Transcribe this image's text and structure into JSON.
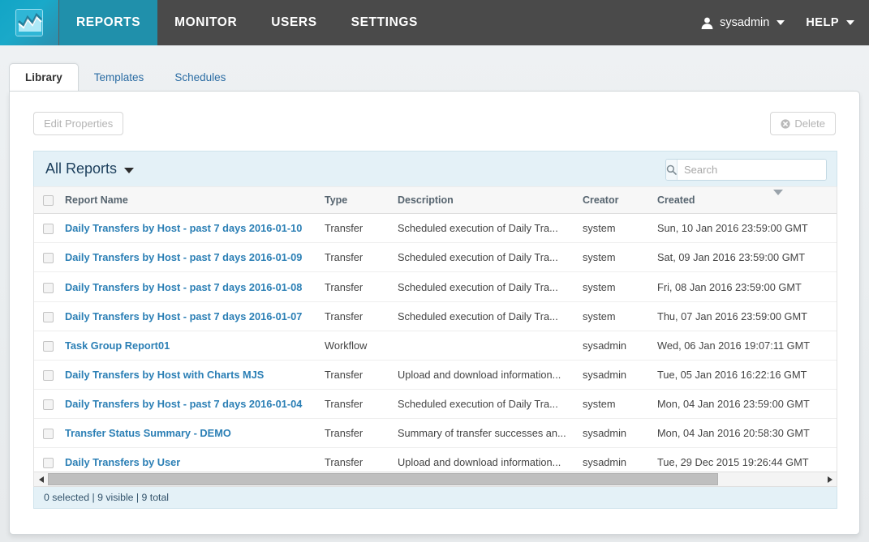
{
  "brand": {
    "logo_icon": "chart-logo-icon",
    "accent": "#1aa9c9",
    "navbar_bg": "#4a4a4a",
    "active_tab_bg": "#2090ab",
    "link_color": "#2b7fb5",
    "panel_blue": "#e4f1f7"
  },
  "topnav": {
    "items": [
      {
        "label": "REPORTS",
        "name": "nav-reports",
        "active": true
      },
      {
        "label": "MONITOR",
        "name": "nav-monitor",
        "active": false
      },
      {
        "label": "USERS",
        "name": "nav-users",
        "active": false
      },
      {
        "label": "SETTINGS",
        "name": "nav-settings",
        "active": false
      }
    ],
    "user": {
      "label": "sysadmin",
      "icon": "user-avatar-icon",
      "caret": "chevron-down-icon"
    },
    "help": {
      "label": "HELP",
      "caret": "chevron-down-icon"
    }
  },
  "tabs": [
    {
      "label": "Library",
      "active": true
    },
    {
      "label": "Templates",
      "active": false
    },
    {
      "label": "Schedules",
      "active": false
    }
  ],
  "toolbar": {
    "edit_properties_label": "Edit Properties",
    "delete_label": "Delete",
    "delete_icon": "circle-x-icon"
  },
  "filterbar": {
    "selector_label": "All Reports",
    "selector_caret": "caret-down-icon",
    "search_icon": "search-icon",
    "search_placeholder": "Search",
    "search_value": ""
  },
  "table": {
    "columns": [
      {
        "key": "select",
        "label": ""
      },
      {
        "key": "name",
        "label": "Report Name"
      },
      {
        "key": "type",
        "label": "Type"
      },
      {
        "key": "description",
        "label": "Description"
      },
      {
        "key": "creator",
        "label": "Creator"
      },
      {
        "key": "created",
        "label": "Created"
      }
    ],
    "sort": {
      "column": "created",
      "direction": "desc",
      "indicator": "sort-desc-triangle"
    },
    "rows": [
      {
        "name": "Daily Transfers by Host - past 7 days 2016-01-10",
        "type": "Transfer",
        "description": "Scheduled execution of Daily Tra...",
        "creator": "system",
        "created": "Sun, 10 Jan 2016 23:59:00 GMT",
        "selected": false
      },
      {
        "name": "Daily Transfers by Host - past 7 days 2016-01-09",
        "type": "Transfer",
        "description": "Scheduled execution of Daily Tra...",
        "creator": "system",
        "created": "Sat, 09 Jan 2016 23:59:00 GMT",
        "selected": false
      },
      {
        "name": "Daily Transfers by Host - past 7 days 2016-01-08",
        "type": "Transfer",
        "description": "Scheduled execution of Daily Tra...",
        "creator": "system",
        "created": "Fri, 08 Jan 2016 23:59:00 GMT",
        "selected": false
      },
      {
        "name": "Daily Transfers by Host - past 7 days 2016-01-07",
        "type": "Transfer",
        "description": "Scheduled execution of Daily Tra...",
        "creator": "system",
        "created": "Thu, 07 Jan 2016 23:59:00 GMT",
        "selected": false
      },
      {
        "name": "Task Group Report01",
        "type": "Workflow",
        "description": "",
        "creator": "sysadmin",
        "created": "Wed, 06 Jan 2016 19:07:11 GMT",
        "selected": false
      },
      {
        "name": "Daily Transfers by Host with Charts MJS",
        "type": "Transfer",
        "description": "Upload and download information...",
        "creator": "sysadmin",
        "created": "Tue, 05 Jan 2016 16:22:16 GMT",
        "selected": false
      },
      {
        "name": "Daily Transfers by Host - past 7 days 2016-01-04",
        "type": "Transfer",
        "description": "Scheduled execution of Daily Tra...",
        "creator": "system",
        "created": "Mon, 04 Jan 2016 23:59:00 GMT",
        "selected": false
      },
      {
        "name": "Transfer Status Summary - DEMO",
        "type": "Transfer",
        "description": "Summary of transfer successes an...",
        "creator": "sysadmin",
        "created": "Mon, 04 Jan 2016 20:58:30 GMT",
        "selected": false
      },
      {
        "name": "Daily Transfers by User",
        "type": "Transfer",
        "description": "Upload and download information...",
        "creator": "sysadmin",
        "created": "Tue, 29 Dec 2015 19:26:44 GMT",
        "selected": false
      }
    ]
  },
  "scrollbar": {
    "left_arrow": "triangle-left-icon",
    "right_arrow": "triangle-right-icon",
    "thumb_fraction": 0.865
  },
  "statusbar": {
    "text": "0 selected | 9 visible | 9 total",
    "selected_count": 0,
    "visible_count": 9,
    "total_count": 9
  }
}
